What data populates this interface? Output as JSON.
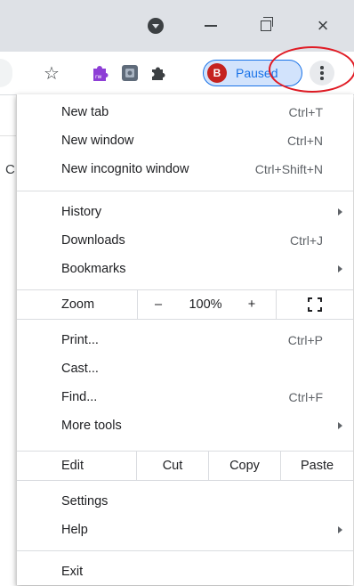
{
  "titlebar": {
    "close_glyph": "×"
  },
  "toolbar": {
    "profile_initial": "B",
    "profile_status": "Paused"
  },
  "page": {
    "partial_text": "C"
  },
  "menu": {
    "group1": [
      {
        "label": "New tab",
        "shortcut": "Ctrl+T"
      },
      {
        "label": "New window",
        "shortcut": "Ctrl+N"
      },
      {
        "label": "New incognito window",
        "shortcut": "Ctrl+Shift+N"
      }
    ],
    "group2": [
      {
        "label": "History",
        "shortcut": ""
      },
      {
        "label": "Downloads",
        "shortcut": "Ctrl+J"
      },
      {
        "label": "Bookmarks",
        "shortcut": ""
      }
    ],
    "zoom": {
      "label": "Zoom",
      "minus": "–",
      "value": "100%",
      "plus": "+"
    },
    "group3": [
      {
        "label": "Print...",
        "shortcut": "Ctrl+P"
      },
      {
        "label": "Cast...",
        "shortcut": ""
      },
      {
        "label": "Find...",
        "shortcut": "Ctrl+F"
      },
      {
        "label": "More tools",
        "shortcut": ""
      }
    ],
    "edit": {
      "label": "Edit",
      "cut": "Cut",
      "copy": "Copy",
      "paste": "Paste"
    },
    "group4": [
      {
        "label": "Settings",
        "shortcut": ""
      },
      {
        "label": "Help",
        "shortcut": ""
      }
    ],
    "exit": {
      "label": "Exit"
    }
  },
  "colors": {
    "titlebar_bg": "#dee1e6",
    "profile_bg": "#d2e3fc",
    "profile_accent": "#1a73e8",
    "avatar_bg": "#c5221f",
    "highlight_circle": "#e01b24"
  }
}
